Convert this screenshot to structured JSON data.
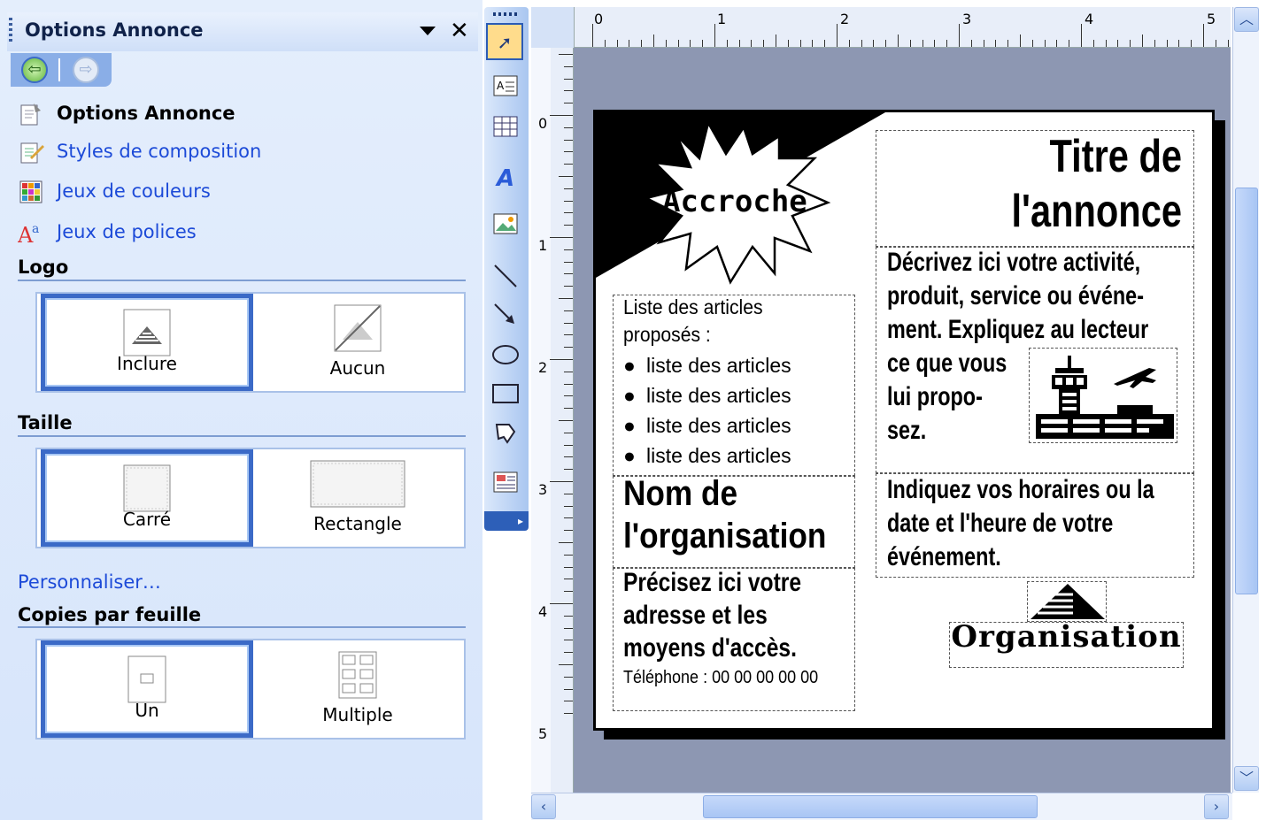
{
  "taskpane": {
    "title": "Options Annonce",
    "links": [
      {
        "label": "Options Annonce",
        "icon": "options-icon"
      },
      {
        "label": "Styles de composition",
        "icon": "styles-icon"
      },
      {
        "label": "Jeux de couleurs",
        "icon": "color-grid-icon"
      },
      {
        "label": "Jeux de polices",
        "icon": "font-icon"
      }
    ],
    "logo": {
      "title": "Logo",
      "options": [
        "Inclure",
        "Aucun"
      ],
      "selected": "Inclure"
    },
    "taille": {
      "title": "Taille",
      "options": [
        "Carré",
        "Rectangle"
      ],
      "selected": "Carré"
    },
    "personnaliser": "Personnaliser…",
    "copies": {
      "title": "Copies par feuille",
      "options": [
        "Un",
        "Multiple"
      ],
      "selected": "Un"
    }
  },
  "ruler": {
    "h_numbers": [
      "0",
      "1",
      "2",
      "3",
      "4",
      "5"
    ],
    "v_numbers": [
      "0",
      "1",
      "2",
      "3",
      "4",
      "5"
    ]
  },
  "flyer": {
    "accroche": "Accroche",
    "title_line1": "Titre de",
    "title_line2": "l'annonce",
    "list_intro_1": "Liste des articles",
    "list_intro_2": "proposés :",
    "list_items": [
      "liste des articles",
      "liste des articles",
      "liste des articles",
      "liste des articles"
    ],
    "description": [
      "Décrivez ici votre activité,",
      "produit, service ou événe-",
      "ment. Expliquez au lecteur",
      "ce que vous",
      "lui propo-",
      "sez."
    ],
    "org_name_1": "Nom de",
    "org_name_2": "l'organisation",
    "address": [
      "Précisez ici votre",
      "adresse et les",
      "moyens d'accès."
    ],
    "phone": "Téléphone : 00 00 00 00 00",
    "hours": [
      "Indiquez vos horaires ou la",
      "date et l'heure de votre",
      "événement."
    ],
    "logo_text": "Organisation"
  },
  "colors": {
    "accent": "#3b6ac7",
    "link": "#1c4ad8",
    "pane_bg": "#d7e5fb"
  }
}
